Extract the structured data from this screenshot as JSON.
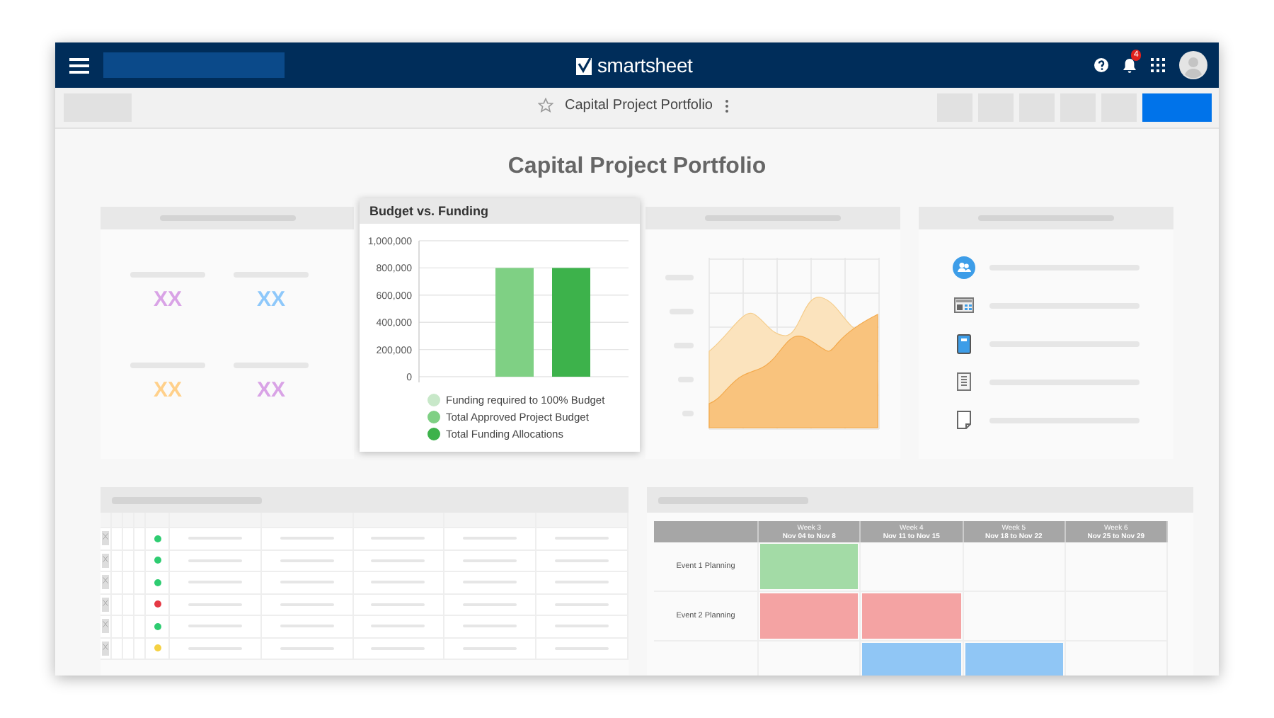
{
  "app": {
    "brand": "smartsheet",
    "notifications": "4"
  },
  "toolbar": {
    "title": "Capital Project Portfolio"
  },
  "dashboard": {
    "title": "Capital Project Portfolio"
  },
  "metrics": [
    {
      "value": "XX",
      "color": "#d9a3e6"
    },
    {
      "value": "XX",
      "color": "#8ec8fa"
    },
    {
      "value": "XX",
      "color": "#ffd08a"
    },
    {
      "value": "XX",
      "color": "#d9a3e6"
    }
  ],
  "budget_widget": {
    "title": "Budget vs. Funding",
    "chart_data": {
      "type": "bar",
      "categories": [
        null
      ],
      "grid": true,
      "series": [
        {
          "name": "Funding required to 100% Budget",
          "color": "#c8e8c9",
          "values": [
            0
          ]
        },
        {
          "name": "Total Approved Project Budget",
          "color": "#7fd084",
          "values": [
            800000
          ]
        },
        {
          "name": "Total Funding Allocations",
          "color": "#3db24b",
          "values": [
            800000
          ]
        }
      ],
      "ylim": [
        0,
        1000000
      ],
      "yticks": [
        {
          "value": 0,
          "label": "0"
        },
        {
          "value": 200000,
          "label": "200,000"
        },
        {
          "value": 400000,
          "label": "400,000"
        },
        {
          "value": 600000,
          "label": "600,000"
        },
        {
          "value": 800000,
          "label": "800,000"
        },
        {
          "value": 1000000,
          "label": "1,000,000"
        }
      ]
    }
  },
  "status_table": {
    "rows": [
      {
        "color": "#2ecc71"
      },
      {
        "color": "#2ecc71"
      },
      {
        "color": "#2ecc71"
      },
      {
        "color": "#e53945"
      },
      {
        "color": "#2ecc71"
      },
      {
        "color": "#f5d142"
      }
    ]
  },
  "schedule": {
    "columns": [
      {
        "week": "Week 3",
        "dates": "Nov 04 to Nov 8"
      },
      {
        "week": "Week 4",
        "dates": "Nov 11 to Nov 15"
      },
      {
        "week": "Week 5",
        "dates": "Nov 18 to Nov 22"
      },
      {
        "week": "Week 6",
        "dates": "Nov 25 to Nov 29"
      }
    ],
    "rows": [
      {
        "label": "Event 1 Planning",
        "color": "#a3dba6",
        "filled": [
          true,
          false,
          false,
          false
        ]
      },
      {
        "label": "Event 2 Planning",
        "color": "#f4a3a3",
        "filled": [
          true,
          true,
          false,
          false
        ]
      },
      {
        "color": "#90c6f5",
        "filled": [
          false,
          true,
          true,
          false
        ]
      }
    ]
  }
}
